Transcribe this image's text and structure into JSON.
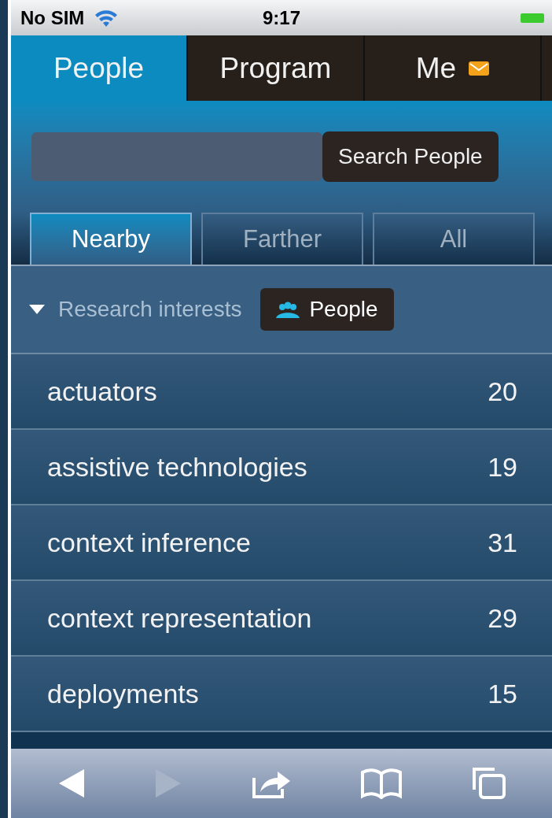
{
  "status_bar": {
    "carrier": "No SIM",
    "time": "9:17"
  },
  "tabs": [
    {
      "label": "People",
      "selected": true,
      "mail": false
    },
    {
      "label": "Program",
      "selected": false,
      "mail": false
    },
    {
      "label": "Me",
      "selected": false,
      "mail": true
    }
  ],
  "search": {
    "button": "Search People"
  },
  "range_tabs": [
    {
      "label": "Nearby",
      "selected": true
    },
    {
      "label": "Farther",
      "selected": false
    },
    {
      "label": "All",
      "selected": false
    }
  ],
  "section": {
    "title": "Research interests",
    "expanded": true,
    "button": "People"
  },
  "rows": [
    {
      "name": "actuators",
      "count": "20"
    },
    {
      "name": "assistive technologies",
      "count": "19"
    },
    {
      "name": "context inference",
      "count": "31"
    },
    {
      "name": "context representation",
      "count": "29"
    },
    {
      "name": "deployments",
      "count": "15"
    }
  ],
  "toolbar": [
    {
      "kind": "back",
      "disabled": false
    },
    {
      "kind": "forward",
      "disabled": true
    },
    {
      "kind": "share",
      "disabled": false
    },
    {
      "kind": "bookmarks",
      "disabled": false
    },
    {
      "kind": "pages",
      "disabled": false
    }
  ]
}
